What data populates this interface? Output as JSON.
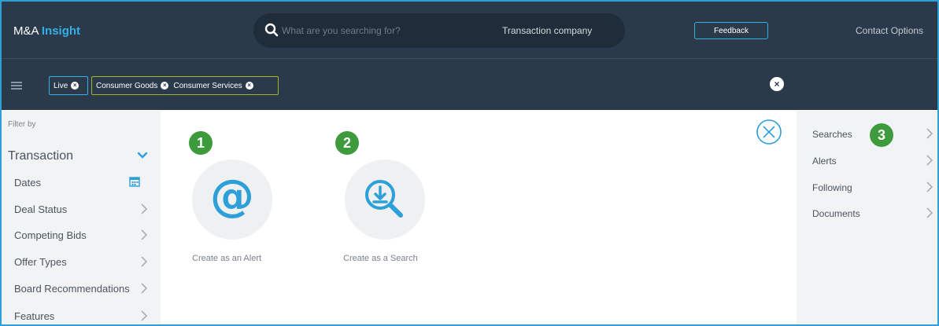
{
  "app": {
    "brand_prefix": "M&A",
    "brand_highlight": "Insight"
  },
  "search": {
    "placeholder": "What are you searching for?",
    "scope": "Transaction company"
  },
  "header": {
    "feedback_label": "Feedback",
    "contact_label": "Contact",
    "options_label": "Options"
  },
  "filters": {
    "chips": [
      {
        "label": "Live"
      },
      {
        "label": "Consumer Goods"
      },
      {
        "label": "Consumer Services"
      }
    ]
  },
  "sidebar": {
    "filter_by": "Filter by",
    "section_title": "Transaction",
    "items": [
      {
        "label": "Dates"
      },
      {
        "label": "Deal Status"
      },
      {
        "label": "Competing Bids"
      },
      {
        "label": "Offer Types"
      },
      {
        "label": "Board Recommendations"
      },
      {
        "label": "Features"
      }
    ]
  },
  "main": {
    "tiles": [
      {
        "number": "1",
        "label": "Create as an Alert",
        "icon_glyph": "@"
      },
      {
        "number": "2",
        "label": "Create as a Search"
      }
    ]
  },
  "right": {
    "badge_number": "3",
    "items": [
      {
        "label": "Searches"
      },
      {
        "label": "Alerts"
      },
      {
        "label": "Following"
      },
      {
        "label": "Documents"
      }
    ]
  },
  "colors": {
    "accent": "#2d9fd9",
    "header_bg": "#2b3a4a",
    "badge_green": "#3d9b3d",
    "chip_olive": "#a6b42a"
  }
}
